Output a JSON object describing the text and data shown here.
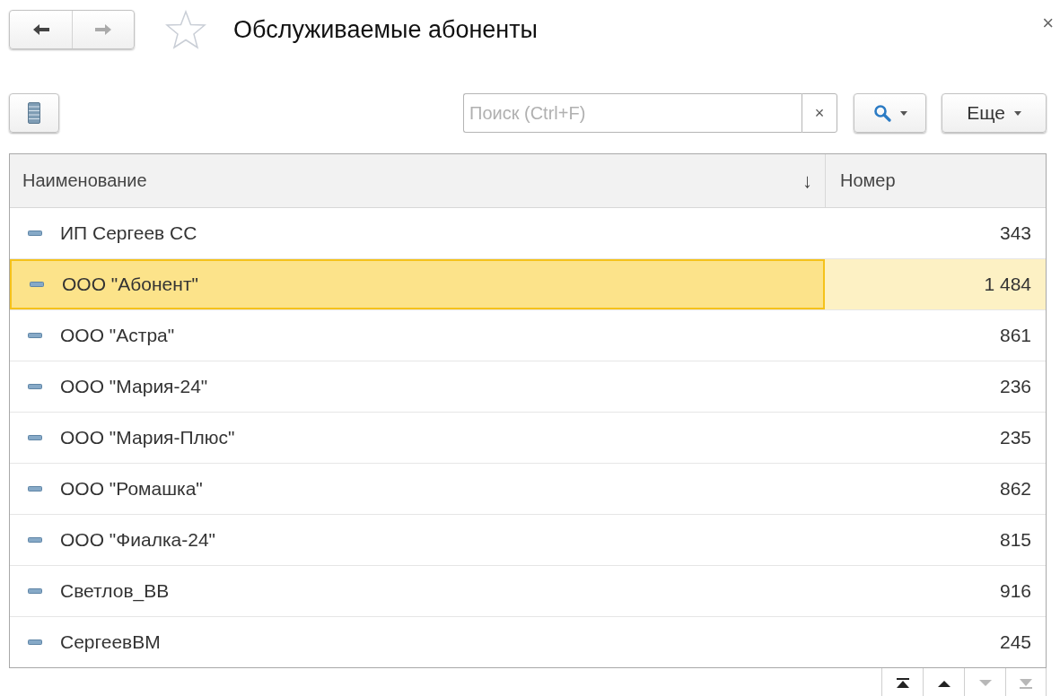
{
  "window": {
    "title": "Обслуживаемые абоненты",
    "close": "×"
  },
  "nav": [
    {
      "kind": "back",
      "disabled": false
    },
    {
      "kind": "forward",
      "disabled": true
    }
  ],
  "search": {
    "placeholder": "Поиск (Ctrl+F)",
    "clear": "×"
  },
  "more_button": "Еще",
  "table": {
    "columns": [
      {
        "label": "Наименование",
        "sort": "↓"
      },
      {
        "label": "Номер"
      }
    ],
    "rows": [
      {
        "name": "ИП Сергеев СС",
        "number": "343",
        "selected": false
      },
      {
        "name": "ООО \"Абонент\"",
        "number": "1 484",
        "selected": true
      },
      {
        "name": "ООО \"Астра\"",
        "number": "861",
        "selected": false
      },
      {
        "name": "ООО \"Мария-24\"",
        "number": "236",
        "selected": false
      },
      {
        "name": "ООО \"Мария-Плюс\"",
        "number": "235",
        "selected": false
      },
      {
        "name": "ООО \"Ромашка\"",
        "number": "862",
        "selected": false
      },
      {
        "name": "ООО \"Фиалка-24\"",
        "number": "815",
        "selected": false
      },
      {
        "name": "Светлов_ВВ",
        "number": "916",
        "selected": false
      },
      {
        "name": "СергеевВМ",
        "number": "245",
        "selected": false
      }
    ]
  },
  "pager": [
    {
      "kind": "first",
      "disabled": false
    },
    {
      "kind": "up",
      "disabled": false
    },
    {
      "kind": "down",
      "disabled": true
    },
    {
      "kind": "last",
      "disabled": true
    }
  ]
}
